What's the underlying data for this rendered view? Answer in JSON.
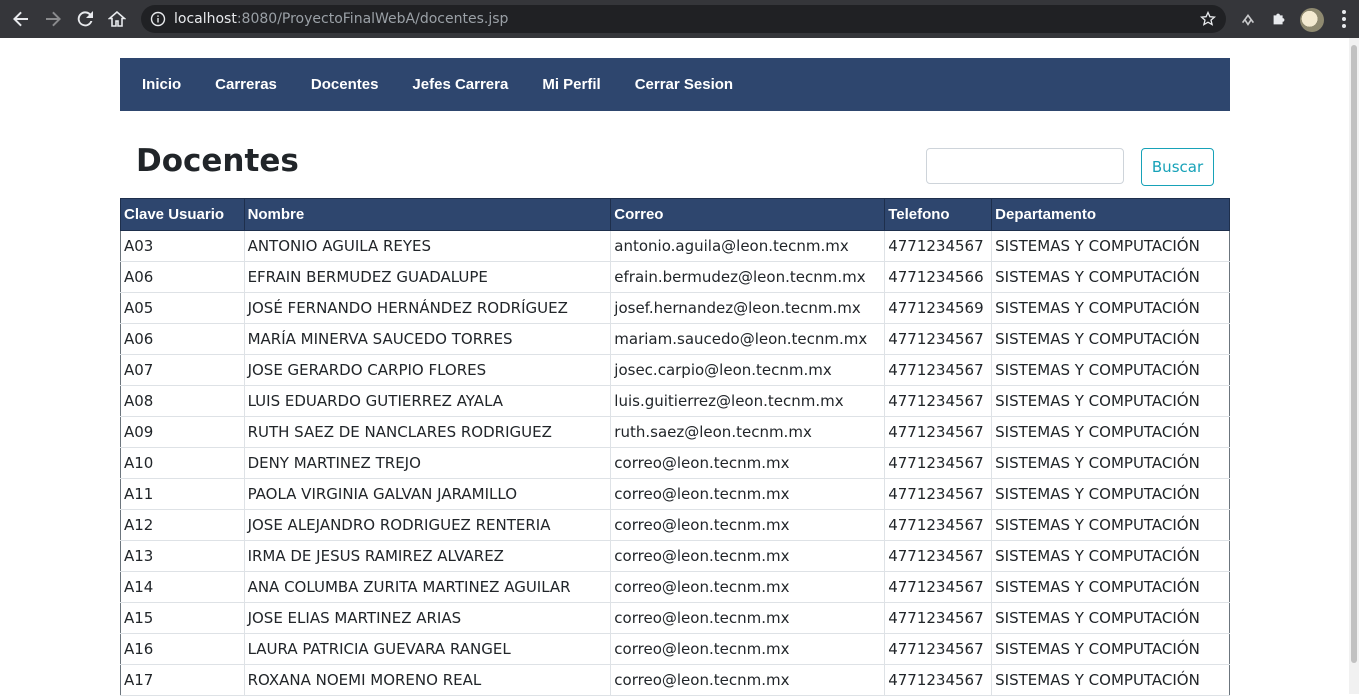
{
  "browser": {
    "url_host": "localhost",
    "url_rest": ":8080/ProyectoFinalWebA/docentes.jsp"
  },
  "nav": {
    "items": [
      "Inicio",
      "Carreras",
      "Docentes",
      "Jefes Carrera",
      "Mi Perfil",
      "Cerrar Sesion"
    ]
  },
  "page": {
    "title": "Docentes",
    "search_value": "",
    "search_button": "Buscar"
  },
  "table": {
    "headers": [
      "Clave Usuario",
      "Nombre",
      "Correo",
      "Telefono",
      "Departamento"
    ],
    "rows": [
      [
        "A03",
        "ANTONIO AGUILA REYES",
        "antonio.aguila@leon.tecnm.mx",
        "4771234567",
        "SISTEMAS Y COMPUTACIÓN"
      ],
      [
        "A06",
        "EFRAIN BERMUDEZ GUADALUPE",
        "efrain.bermudez@leon.tecnm.mx",
        "4771234566",
        "SISTEMAS Y COMPUTACIÓN"
      ],
      [
        "A05",
        "JOSÉ FERNANDO HERNÁNDEZ RODRÍGUEZ",
        "josef.hernandez@leon.tecnm.mx",
        "4771234569",
        "SISTEMAS Y COMPUTACIÓN"
      ],
      [
        "A06",
        "MARÍA MINERVA SAUCEDO TORRES",
        "mariam.saucedo@leon.tecnm.mx",
        "4771234567",
        "SISTEMAS Y COMPUTACIÓN"
      ],
      [
        "A07",
        "JOSE GERARDO CARPIO FLORES",
        "josec.carpio@leon.tecnm.mx",
        "4771234567",
        "SISTEMAS Y COMPUTACIÓN"
      ],
      [
        "A08",
        "LUIS EDUARDO GUTIERREZ AYALA",
        "luis.guitierrez@leon.tecnm.mx",
        "4771234567",
        "SISTEMAS Y COMPUTACIÓN"
      ],
      [
        "A09",
        "RUTH SAEZ DE NANCLARES RODRIGUEZ",
        "ruth.saez@leon.tecnm.mx",
        "4771234567",
        "SISTEMAS Y COMPUTACIÓN"
      ],
      [
        "A10",
        "DENY MARTINEZ TREJO",
        "correo@leon.tecnm.mx",
        "4771234567",
        "SISTEMAS Y COMPUTACIÓN"
      ],
      [
        "A11",
        "PAOLA VIRGINIA GALVAN JARAMILLO",
        "correo@leon.tecnm.mx",
        "4771234567",
        "SISTEMAS Y COMPUTACIÓN"
      ],
      [
        "A12",
        "JOSE ALEJANDRO RODRIGUEZ RENTERIA",
        "correo@leon.tecnm.mx",
        "4771234567",
        "SISTEMAS Y COMPUTACIÓN"
      ],
      [
        "A13",
        "IRMA DE JESUS RAMIREZ ALVAREZ",
        "correo@leon.tecnm.mx",
        "4771234567",
        "SISTEMAS Y COMPUTACIÓN"
      ],
      [
        "A14",
        "ANA COLUMBA ZURITA MARTINEZ AGUILAR",
        "correo@leon.tecnm.mx",
        "4771234567",
        "SISTEMAS Y COMPUTACIÓN"
      ],
      [
        "A15",
        "JOSE ELIAS MARTINEZ ARIAS",
        "correo@leon.tecnm.mx",
        "4771234567",
        "SISTEMAS Y COMPUTACIÓN"
      ],
      [
        "A16",
        "LAURA PATRICIA GUEVARA RANGEL",
        "correo@leon.tecnm.mx",
        "4771234567",
        "SISTEMAS Y COMPUTACIÓN"
      ],
      [
        "A17",
        "ROXANA NOEMI MORENO REAL",
        "correo@leon.tecnm.mx",
        "4771234567",
        "SISTEMAS Y COMPUTACIÓN"
      ]
    ]
  }
}
